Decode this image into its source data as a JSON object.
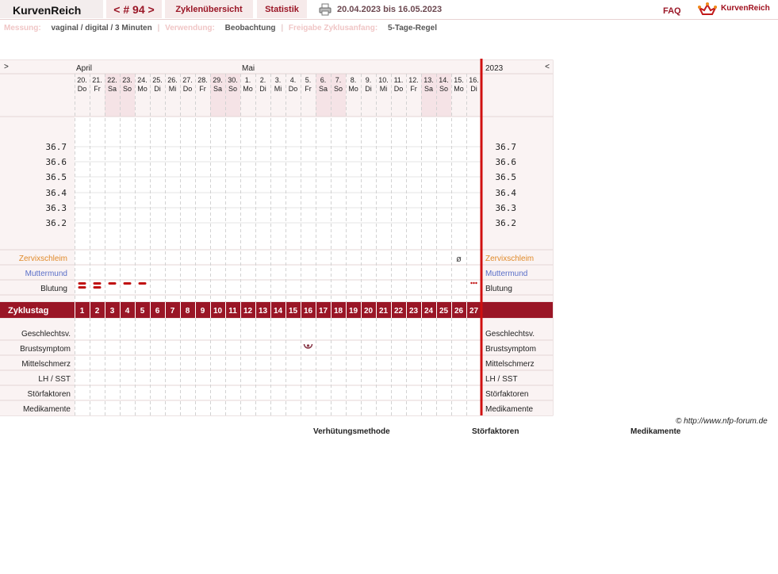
{
  "header": {
    "brand": "KurvenReich",
    "nav_prev": "<",
    "nav_hash": "#",
    "nav_number": "94",
    "nav_next": ">",
    "tab_overview": "Zyklenübersicht",
    "tab_stats": "Statistik",
    "date_range": "20.04.2023 bis 16.05.2023",
    "faq": "FAQ",
    "logo_text": "KurvenReich"
  },
  "measurement": {
    "measure_label": "Messung:",
    "measure_value": "vaginal / digital / 3 Minuten",
    "use_label": "Verwendung:",
    "use_value": "Beobachtung",
    "release_label": "Freigabe Zyklusanfang:",
    "release_value": "5-Tage-Regel"
  },
  "chart_data": {
    "type": "table",
    "nav_left": ">",
    "nav_right": "<",
    "year": "2023",
    "months": [
      {
        "label": "April",
        "start_index": 0
      },
      {
        "label": "Mai",
        "start_index": 11
      }
    ],
    "days": [
      {
        "date": "20.",
        "wd": "Do",
        "we": false
      },
      {
        "date": "21.",
        "wd": "Fr",
        "we": false
      },
      {
        "date": "22.",
        "wd": "Sa",
        "we": true
      },
      {
        "date": "23.",
        "wd": "So",
        "we": true
      },
      {
        "date": "24.",
        "wd": "Mo",
        "we": false
      },
      {
        "date": "25.",
        "wd": "Di",
        "we": false
      },
      {
        "date": "26.",
        "wd": "Mi",
        "we": false
      },
      {
        "date": "27.",
        "wd": "Do",
        "we": false
      },
      {
        "date": "28.",
        "wd": "Fr",
        "we": false
      },
      {
        "date": "29.",
        "wd": "Sa",
        "we": true
      },
      {
        "date": "30.",
        "wd": "So",
        "we": true
      },
      {
        "date": "1.",
        "wd": "Mo",
        "we": false
      },
      {
        "date": "2.",
        "wd": "Di",
        "we": false
      },
      {
        "date": "3.",
        "wd": "Mi",
        "we": false
      },
      {
        "date": "4.",
        "wd": "Do",
        "we": false
      },
      {
        "date": "5.",
        "wd": "Fr",
        "we": false
      },
      {
        "date": "6.",
        "wd": "Sa",
        "we": true
      },
      {
        "date": "7.",
        "wd": "So",
        "we": true
      },
      {
        "date": "8.",
        "wd": "Mo",
        "we": false
      },
      {
        "date": "9.",
        "wd": "Di",
        "we": false
      },
      {
        "date": "10.",
        "wd": "Mi",
        "we": false
      },
      {
        "date": "11.",
        "wd": "Do",
        "we": false
      },
      {
        "date": "12.",
        "wd": "Fr",
        "we": false
      },
      {
        "date": "13.",
        "wd": "Sa",
        "we": true
      },
      {
        "date": "14.",
        "wd": "So",
        "we": true
      },
      {
        "date": "15.",
        "wd": "Mo",
        "we": false
      },
      {
        "date": "16.",
        "wd": "Di",
        "we": false
      }
    ],
    "temp_ticks": [
      "36.7",
      "36.6",
      "36.5",
      "36.4",
      "36.3",
      "36.2"
    ],
    "rows_top": [
      {
        "label": "Zervixschleim",
        "color": "#e08a2a"
      },
      {
        "label": "Muttermund",
        "color": "#5a6fc8"
      },
      {
        "label": "Blutung",
        "color": "#222222"
      }
    ],
    "bleeding": [
      {
        "day": 1,
        "level": "heavy"
      },
      {
        "day": 2,
        "level": "heavy"
      },
      {
        "day": 3,
        "level": "medium"
      },
      {
        "day": 4,
        "level": "medium"
      },
      {
        "day": 5,
        "level": "medium"
      },
      {
        "day": 27,
        "level": "spotting"
      }
    ],
    "cervix_marks": [
      {
        "day": 26,
        "symbol": "ø"
      }
    ],
    "cycle_label": "Zyklustag",
    "cycle_days": [
      "1",
      "2",
      "3",
      "4",
      "5",
      "6",
      "7",
      "8",
      "9",
      "10",
      "11",
      "12",
      "13",
      "14",
      "15",
      "16",
      "17",
      "18",
      "19",
      "20",
      "21",
      "22",
      "23",
      "24",
      "25",
      "26",
      "27"
    ],
    "rows_bottom": [
      "Geschlechtsv.",
      "Brustsymptom",
      "Mittelschmerz",
      "LH / SST",
      "Störfaktoren",
      "Medikamente"
    ],
    "breast_marks": [
      {
        "day": 16,
        "symbol": "breast-symptom-icon"
      }
    ],
    "colors": {
      "accent": "#9a1626",
      "weekend": "#f5e3e6",
      "panel": "#faf3f3",
      "grid": "#cccccc",
      "line": "#d01010"
    }
  },
  "footer": {
    "copyright": "© http://www.nfp-forum.de",
    "legend_method": "Verhütungsmethode",
    "legend_disturb": "Störfaktoren",
    "legend_meds": "Medikamente"
  }
}
